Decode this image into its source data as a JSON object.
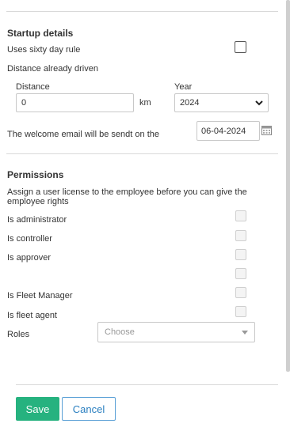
{
  "startup": {
    "title": "Startup details",
    "sixty_day_label": "Uses sixty day rule",
    "distance_driven_label": "Distance already driven",
    "distance_label": "Distance",
    "distance_value": "0",
    "distance_unit": "km",
    "year_label": "Year",
    "year_value": "2024",
    "welcome_label": "The welcome email will be sendt on the",
    "welcome_date": "06-04-2024"
  },
  "permissions": {
    "title": "Permissions",
    "note": "Assign a user license to the employee before you can give the employee rights",
    "items": [
      {
        "label": "Is administrator"
      },
      {
        "label": "Is controller"
      },
      {
        "label": "Is approver"
      },
      {
        "label": ""
      },
      {
        "label": "Is Fleet Manager"
      },
      {
        "label": "Is fleet agent"
      }
    ],
    "roles_label": "Roles",
    "roles_placeholder": "Choose"
  },
  "actions": {
    "save": "Save",
    "cancel": "Cancel"
  },
  "colors": {
    "save_bg": "#26b27f",
    "cancel_text": "#2a7fc0"
  }
}
